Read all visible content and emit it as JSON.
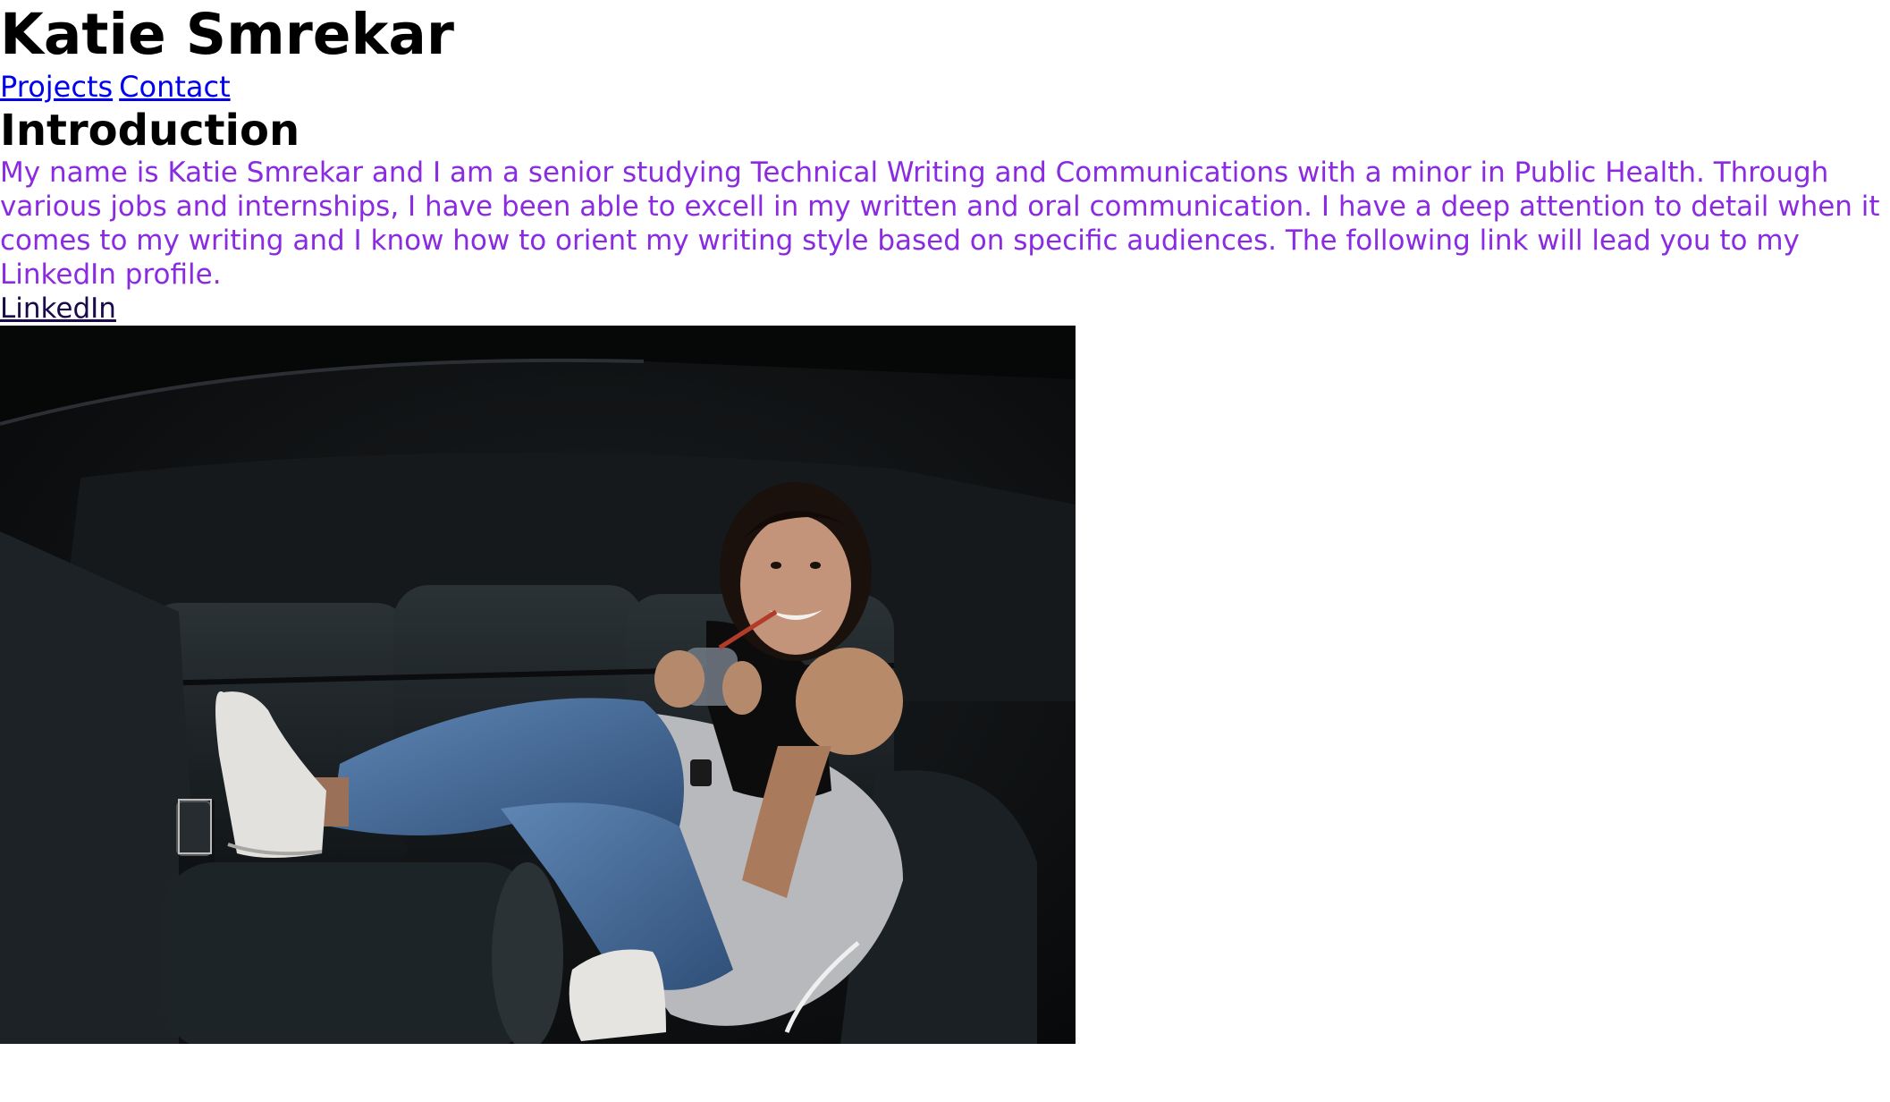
{
  "header": {
    "title": "Katie Smrekar"
  },
  "nav": {
    "items": [
      {
        "label": "Projects"
      },
      {
        "label": "Contact"
      }
    ]
  },
  "main": {
    "heading": "Introduction",
    "intro": "My name is Katie Smrekar and I am a senior studying Technical Writing and Communications with a minor in Public Health. Through various jobs and internships, I have been able to excell in my written and oral communication. I have a deep attention to detail when it comes to my writing and I know how to orient my writing style based on specific audiences. The following link will lead you to my LinkedIn profile.",
    "linkedin_label": "LinkedIn"
  },
  "colors": {
    "intro_text": "#8a2be2",
    "nav_link": "#0000ee",
    "visited_link": "#1a0a4a"
  }
}
